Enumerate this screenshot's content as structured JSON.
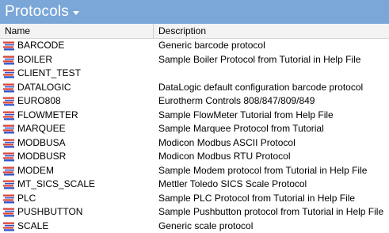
{
  "title": "Protocols",
  "columns": {
    "name": "Name",
    "description": "Description"
  },
  "icon": "protocol-icon",
  "rows": [
    {
      "name": "BARCODE",
      "description": "Generic barcode protocol"
    },
    {
      "name": "BOILER",
      "description": "Sample Boiler Protocol from Tutorial in Help File"
    },
    {
      "name": "CLIENT_TEST",
      "description": ""
    },
    {
      "name": "DATALOGIC",
      "description": "DataLogic default configuration barcode protocol"
    },
    {
      "name": "EURO808",
      "description": "Eurotherm Controls 808/847/809/849"
    },
    {
      "name": "FLOWMETER",
      "description": "Sample FlowMeter Tutorial from Help File"
    },
    {
      "name": "MARQUEE",
      "description": "Sample Marquee Protocol from Tutorial"
    },
    {
      "name": "MODBUSA",
      "description": "Modicon Modbus ASCII Protocol"
    },
    {
      "name": "MODBUSR",
      "description": "Modicon Modbus RTU Protocol"
    },
    {
      "name": "MODEM",
      "description": "Sample Modem protocol from Tutorial in Help File"
    },
    {
      "name": "MT_SICS_SCALE",
      "description": "Mettler Toledo SICS Scale Protocol"
    },
    {
      "name": "PLC",
      "description": "Sample PLC Protocol from Tutorial in Help File"
    },
    {
      "name": "PUSHBUTTON",
      "description": "Sample Pushbutton protocol from Tutorial in Help File"
    },
    {
      "name": "SCALE",
      "description": "Generic scale protocol"
    }
  ],
  "colors": {
    "titlebar": "#7aa6d8",
    "icon_red": "#d9463a",
    "icon_blue": "#2f53c9"
  }
}
